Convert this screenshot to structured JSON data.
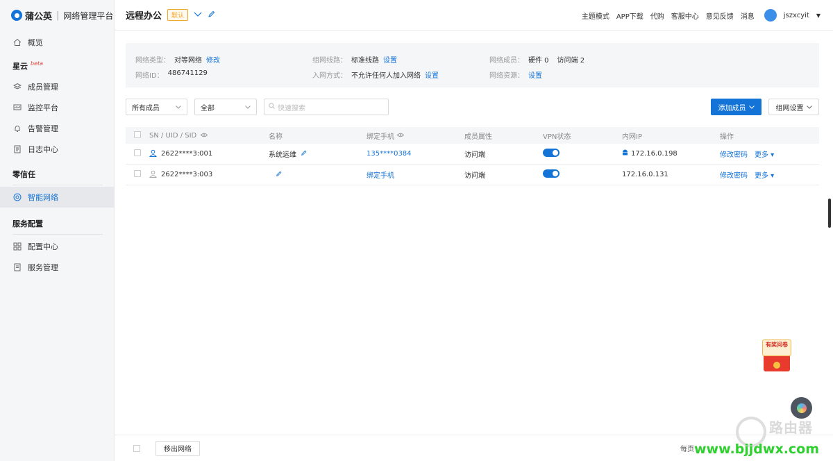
{
  "app": {
    "brand": "蒲公英",
    "subtitle": "网络管理平台"
  },
  "sidebar": {
    "items": [
      {
        "label": "概览",
        "icon": "home-icon"
      },
      {
        "group": "星云",
        "badge": "beta"
      },
      {
        "label": "成员管理",
        "icon": "layers-icon"
      },
      {
        "label": "监控平台",
        "icon": "monitor-icon"
      },
      {
        "label": "告警管理",
        "icon": "bell-icon"
      },
      {
        "label": "日志中心",
        "icon": "log-icon"
      },
      {
        "group": "零信任"
      },
      {
        "label": "智能网络",
        "icon": "network-icon",
        "active": true
      },
      {
        "group": "服务配置"
      },
      {
        "label": "配置中心",
        "icon": "grid-icon"
      },
      {
        "label": "服务管理",
        "icon": "doc-icon"
      }
    ]
  },
  "header": {
    "title": "远程办公",
    "default_tag": "默认",
    "links": [
      "主题模式",
      "APP下载",
      "代购",
      "客服中心",
      "意见反馈",
      "消息"
    ],
    "username": "jszxcyit"
  },
  "info": {
    "network_type_label": "网络类型：",
    "network_type": "对等网络",
    "network_type_action": "修改",
    "network_id_label": "网络ID：",
    "network_id": "486741129",
    "route_label": "组网线路：",
    "route": "标准线路",
    "route_action": "设置",
    "join_label": "入网方式：",
    "join": "不允许任何人加入网络",
    "join_action": "设置",
    "members_label": "网络成员：",
    "members_hw": "硬件 0",
    "members_client": "访问端 2",
    "resources_label": "网络资源：",
    "resources_action": "设置"
  },
  "filters": {
    "member_filter": "所有成员",
    "status_filter": "全部",
    "search_placeholder": "快速搜索",
    "add_member": "添加成员",
    "network_settings": "组网设置"
  },
  "table": {
    "columns": [
      "SN / UID / SID",
      "名称",
      "绑定手机",
      "成员属性",
      "VPN状态",
      "内网IP",
      "操作"
    ],
    "rows": [
      {
        "sn": "2622****3:001",
        "name": "系统运维",
        "phone": "135****0384",
        "attr": "访问端",
        "vpn": "on",
        "ip": "172.16.0.198",
        "op1": "修改密码",
        "op2": "更多"
      },
      {
        "sn": "2622****3:003",
        "name": "",
        "phone": "绑定手机",
        "attr": "访问端",
        "vpn": "on",
        "ip": "172.16.0.131",
        "op1": "修改密码",
        "op2": "更多"
      }
    ]
  },
  "footer": {
    "remove_button": "移出网络",
    "per_page_label": "每页"
  },
  "widgets": {
    "survey_text": "有奖问卷"
  },
  "watermark": {
    "cn": "路由器",
    "url": "www.bjjdwx.com"
  },
  "colors": {
    "accent": "#1473d6",
    "tag": "#f5a623",
    "sidebar_bg": "#f5f6f8"
  }
}
